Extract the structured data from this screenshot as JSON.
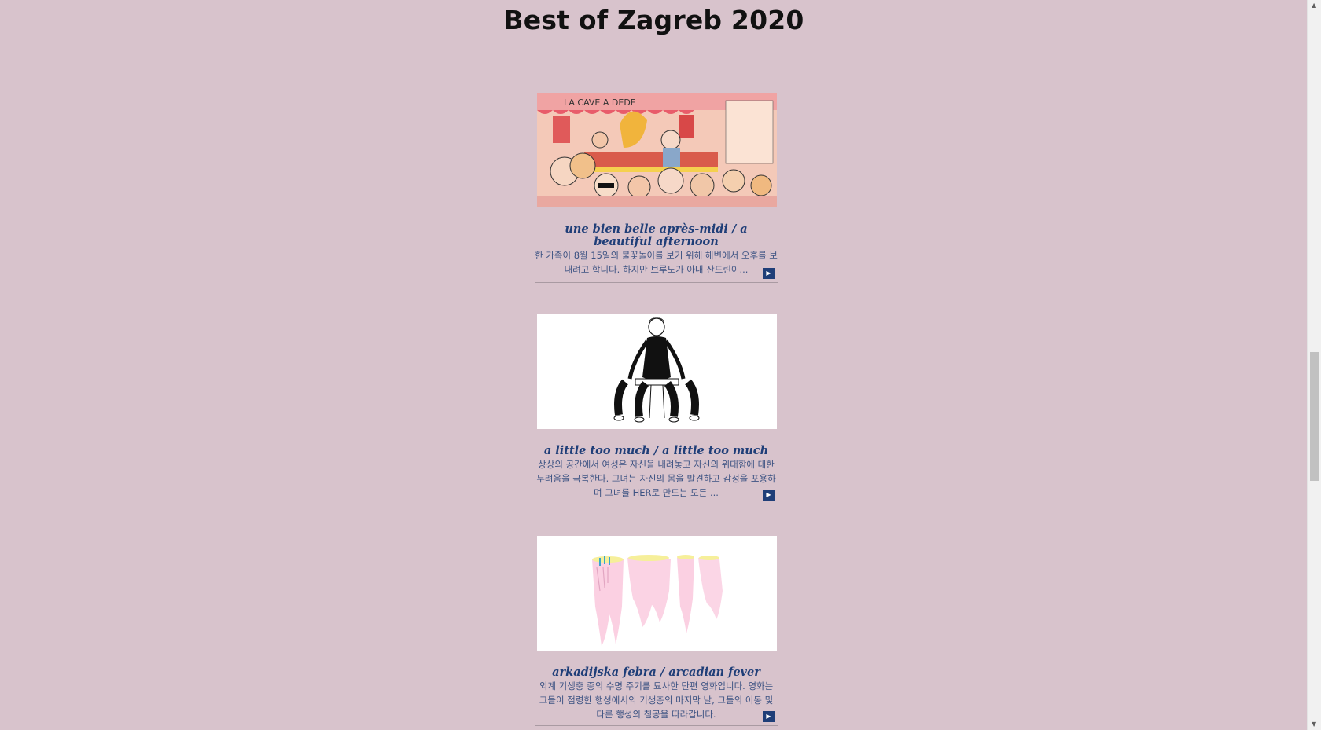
{
  "page": {
    "title": "Best of Zagreb 2020"
  },
  "films": [
    {
      "title": "une bien belle après-midi / a beautiful afternoon",
      "description": "한 가족이 8월 15일의 불꽃놀이를 보기 위해 해변에서 오후를 보내려고 합니다. 하지만 브루노가 아내 산드린이...",
      "thumbnail_icon": "la-cave-a-dede-illustration",
      "sign_text": "LA CAVE A DEDE"
    },
    {
      "title": "a little too much / a little too much",
      "description": "상상의 공간에서 여성은 자신을 내려놓고 자신의 위대함에 대한 두려움을 극복한다. 그녀는 자신의 몸을 발견하고 감정을 포용하며 그녀를 HER로 만드는 모든 ...",
      "thumbnail_icon": "woman-on-stool-illustration"
    },
    {
      "title": "arkadijska febra / arcadian fever",
      "description": "외계 기생충 종의 수명 주기를 묘사한 단편 영화입니다. 영화는 그들이 점령한 행성에서의 기생충의 마지막 날, 그들의 이동 및 다른 행성의 침공을 따라갑니다.",
      "thumbnail_icon": "pink-parasite-illustration"
    }
  ],
  "more_button_icon": "play-arrow-icon",
  "colors": {
    "background": "#d8c3cc",
    "title_link": "#1f3e78",
    "description_text": "#3d5383"
  }
}
